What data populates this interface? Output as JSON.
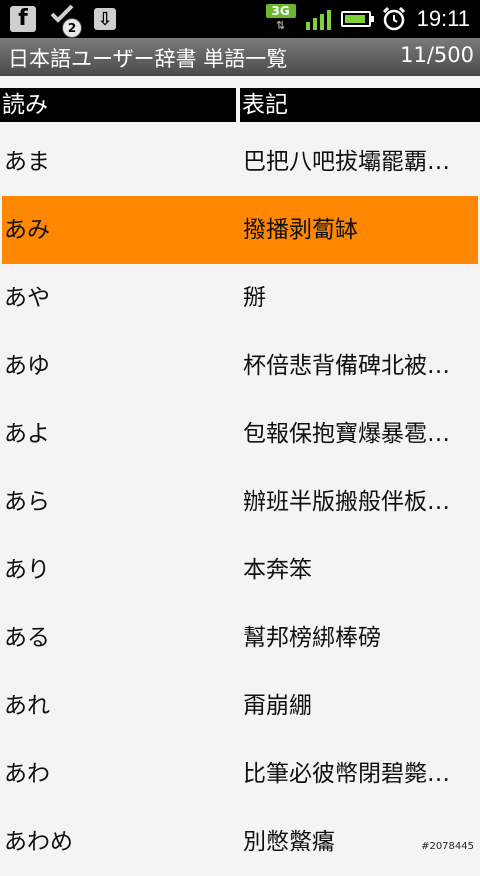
{
  "status_bar": {
    "icons_left": [
      "facebook-icon",
      "check-notification-icon",
      "download-icon"
    ],
    "notification_badge": "2",
    "network_type": "3G",
    "time": "19:11",
    "colors": {
      "network_green": "#6ab82e",
      "signal_green": "#7fd13b"
    }
  },
  "titlebar": {
    "title": "日本語ユーザー辞書 単語一覧",
    "counter": "11/500"
  },
  "columns": {
    "reading": "読み",
    "notation": "表記"
  },
  "selected_color": "#ff8800",
  "rows": [
    {
      "reading": "あま",
      "notation": "巴把八吧拔壩罷覇…"
    },
    {
      "reading": "あみ",
      "notation": "撥播剥蔔缽",
      "selected": true
    },
    {
      "reading": "あや",
      "notation": "掰"
    },
    {
      "reading": "あゆ",
      "notation": "杯倍悲背備碑北被…"
    },
    {
      "reading": "あよ",
      "notation": "包報保抱寶爆暴雹…"
    },
    {
      "reading": "あら",
      "notation": "辦班半版搬般伴板…"
    },
    {
      "reading": "あり",
      "notation": "本奔笨"
    },
    {
      "reading": "ある",
      "notation": "幫邦榜綁棒磅"
    },
    {
      "reading": "あれ",
      "notation": "甭崩綳"
    },
    {
      "reading": "あわ",
      "notation": "比筆必彼幣閉碧斃…"
    },
    {
      "reading": "あわめ",
      "notation": "別憋鱉癟"
    }
  ],
  "watermark": "#2078445"
}
